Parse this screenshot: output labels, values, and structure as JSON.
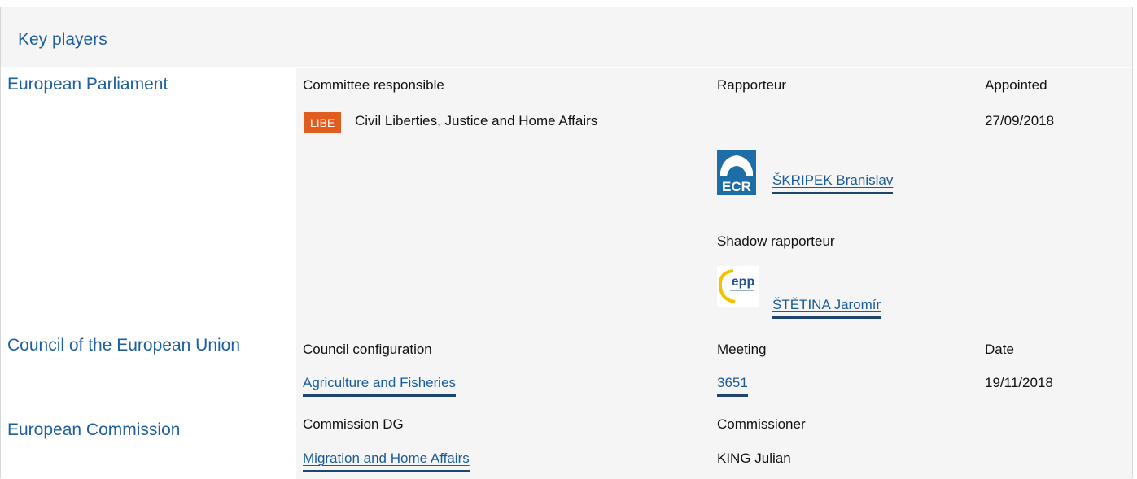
{
  "title": "Key players",
  "ep": {
    "name": "European Parliament",
    "col_committee": "Committee responsible",
    "col_rapporteur": "Rapporteur",
    "col_appointed": "Appointed",
    "committee_code": "LIBE",
    "committee_name": "Civil Liberties, Justice and Home Affairs",
    "appointed_date": "27/09/2018",
    "rapporteur_group": "ECR",
    "rapporteur_name": "ŠKRIPEK Branislav",
    "shadow_label": "Shadow rapporteur",
    "shadow_group": "epp",
    "shadow_name": "ŠTĚTINA Jaromír"
  },
  "council": {
    "name": "Council of the European Union",
    "col_configuration": "Council configuration",
    "col_meeting": "Meeting",
    "col_date": "Date",
    "configuration": "Agriculture and Fisheries",
    "meeting": "3651",
    "date": "19/11/2018"
  },
  "commission": {
    "name": "European Commission",
    "col_dg": "Commission DG",
    "col_commissioner": "Commissioner",
    "dg": "Migration and Home Affairs",
    "commissioner": "KING Julian"
  },
  "colors": {
    "heading_blue": "#1f5f9f",
    "link_blue": "#1a5c99",
    "badge_orange": "#e05d1f",
    "panel_grey": "#f5f5f5"
  }
}
